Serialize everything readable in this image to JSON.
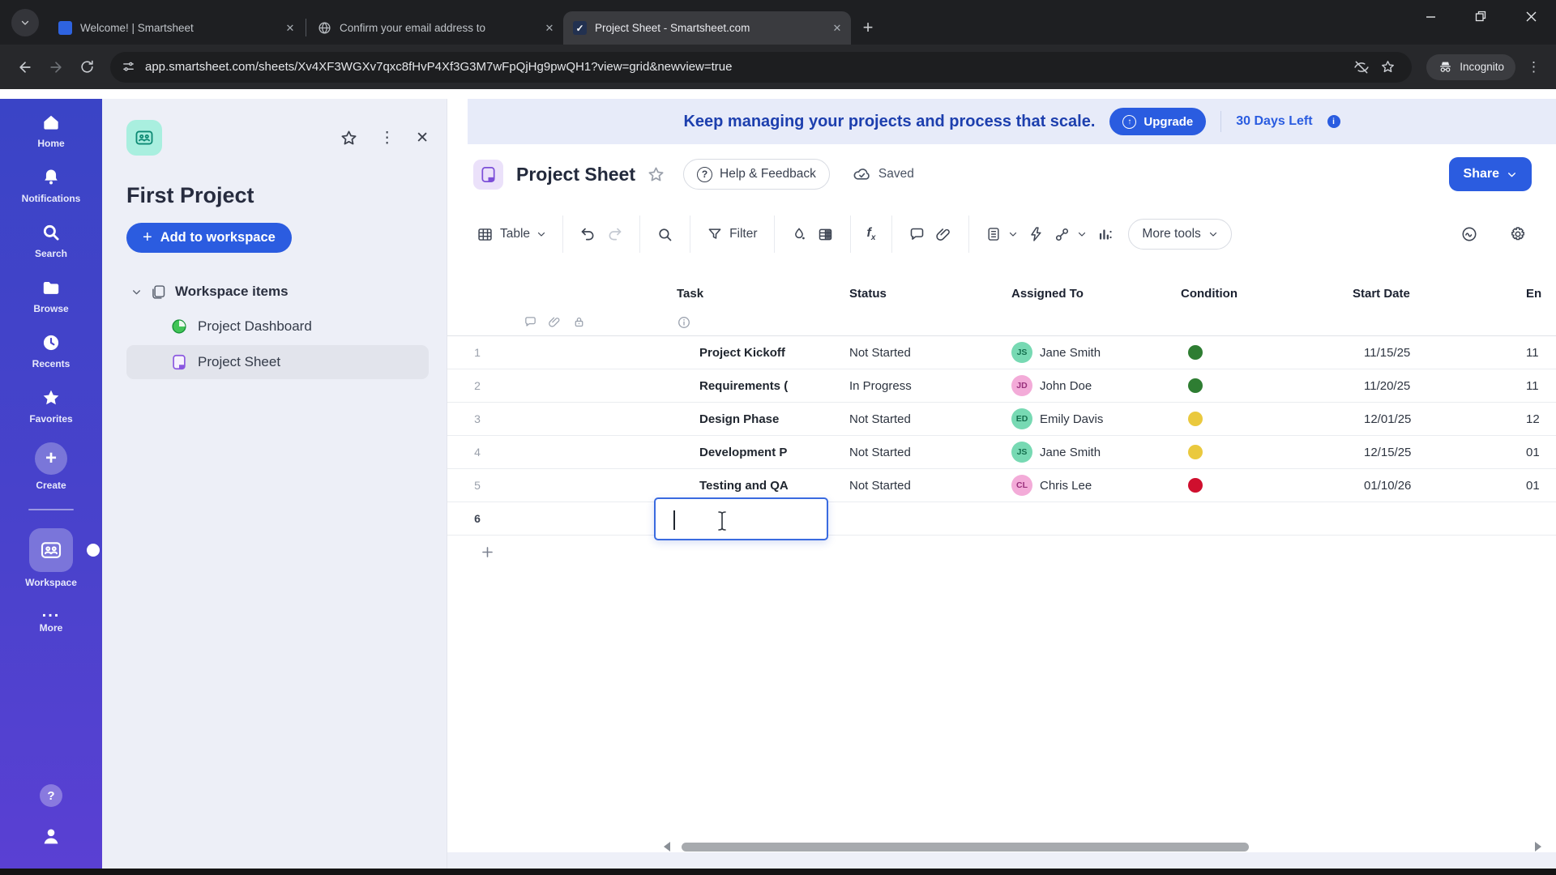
{
  "browser": {
    "tabs": [
      {
        "title": "Welcome! | Smartsheet",
        "favicon": "smartsheet-logo",
        "active": false
      },
      {
        "title": "Confirm your email address to",
        "favicon": "globe",
        "active": false
      },
      {
        "title": "Project Sheet - Smartsheet.com",
        "favicon": "checkmark",
        "active": true
      }
    ],
    "url": "app.smartsheet.com/sheets/Xv4XF3WGXv7qxc8fHvP4Xf3G3M7wFpQjHg9pwQH1?view=grid&newview=true",
    "incognito_label": "Incognito",
    "check_glyph": "✓",
    "new_tab_glyph": "+"
  },
  "rail": {
    "items": [
      {
        "icon": "home-icon",
        "label": "Home"
      },
      {
        "icon": "bell-icon",
        "label": "Notifications"
      },
      {
        "icon": "search-icon",
        "label": "Search"
      },
      {
        "icon": "folder-icon",
        "label": "Browse"
      },
      {
        "icon": "clock-icon",
        "label": "Recents"
      },
      {
        "icon": "star-icon",
        "label": "Favorites"
      },
      {
        "icon": "plus-icon",
        "label": "Create"
      },
      {
        "icon": "workspace-icon",
        "label": "Workspace",
        "active": true
      },
      {
        "icon": "ellipsis-icon",
        "label": "More"
      }
    ],
    "create_glyph": "+",
    "more_glyph": "...",
    "help_glyph": "?"
  },
  "panel": {
    "title": "First Project",
    "add_button_label": "Add to workspace",
    "add_button_glyph": "+",
    "close_glyph": "✕",
    "kebab_glyph": "⋮",
    "tree": [
      {
        "label": "Workspace items",
        "icon": "pages-icon"
      },
      {
        "label": "Project Dashboard",
        "icon": "dashboard-pie-icon"
      },
      {
        "label": "Project Sheet",
        "icon": "sheet-icon",
        "selected": true
      }
    ]
  },
  "banner": {
    "message": "Keep managing your projects and process that scale.",
    "upgrade_label": "Upgrade",
    "upgrade_glyph": "↑",
    "days_left": "30 Days Left",
    "info_glyph": "i"
  },
  "sheet": {
    "title": "Project Sheet",
    "help_label": "Help & Feedback",
    "help_glyph": "?",
    "saved_label": "Saved",
    "share_label": "Share"
  },
  "toolbar": {
    "view_label": "Table",
    "filter_label": "Filter",
    "more_tools_label": "More tools",
    "icons": [
      "table-view-icon",
      "chevron-down-icon",
      "undo-icon",
      "redo-icon",
      "search-icon",
      "filter-funnel-icon",
      "fill-color-icon",
      "cells-icon",
      "formula-icon",
      "comment-icon",
      "paperclip-icon",
      "document-icon",
      "bolt-icon",
      "link-icon",
      "bar-chart-icon",
      "history-icon",
      "gear-icon"
    ]
  },
  "grid": {
    "columns": [
      "Task",
      "Status",
      "Assigned To",
      "Condition",
      "Start Date",
      "En"
    ],
    "rows": [
      {
        "num": "1",
        "task": "Project Kickoff",
        "status": "Not Started",
        "initials": "JS",
        "avatar_color": "green",
        "assignee": "Jane Smith",
        "condition": "green",
        "start": "11/15/25",
        "end": "11"
      },
      {
        "num": "2",
        "task": "Requirements (",
        "status": "In Progress",
        "initials": "JD",
        "avatar_color": "pink",
        "assignee": "John Doe",
        "condition": "green",
        "start": "11/20/25",
        "end": "11"
      },
      {
        "num": "3",
        "task": "Design Phase",
        "status": "Not Started",
        "initials": "ED",
        "avatar_color": "green",
        "assignee": "Emily Davis",
        "condition": "yellow",
        "start": "12/01/25",
        "end": "12"
      },
      {
        "num": "4",
        "task": "Development P",
        "status": "Not Started",
        "initials": "JS",
        "avatar_color": "green",
        "assignee": "Jane Smith",
        "condition": "yellow",
        "start": "12/15/25",
        "end": "01"
      },
      {
        "num": "5",
        "task": "Testing and QA",
        "status": "Not Started",
        "initials": "CL",
        "avatar_color": "pink",
        "assignee": "Chris Lee",
        "condition": "red",
        "start": "01/10/26",
        "end": "01"
      }
    ],
    "editing_row_number": "6"
  },
  "colors": {
    "accent_blue": "#2b5ce0",
    "rail_gradient_top": "#3a44c6",
    "rail_gradient_bottom": "#5a40d3",
    "banner_bg": "#e7ebf9",
    "condition_green": "#2e7d32",
    "condition_yellow": "#eac93e",
    "condition_red": "#cf0f2e",
    "avatar_green": "#77d9b3",
    "avatar_pink": "#f3abd8",
    "edit_border": "#3a6be0"
  }
}
